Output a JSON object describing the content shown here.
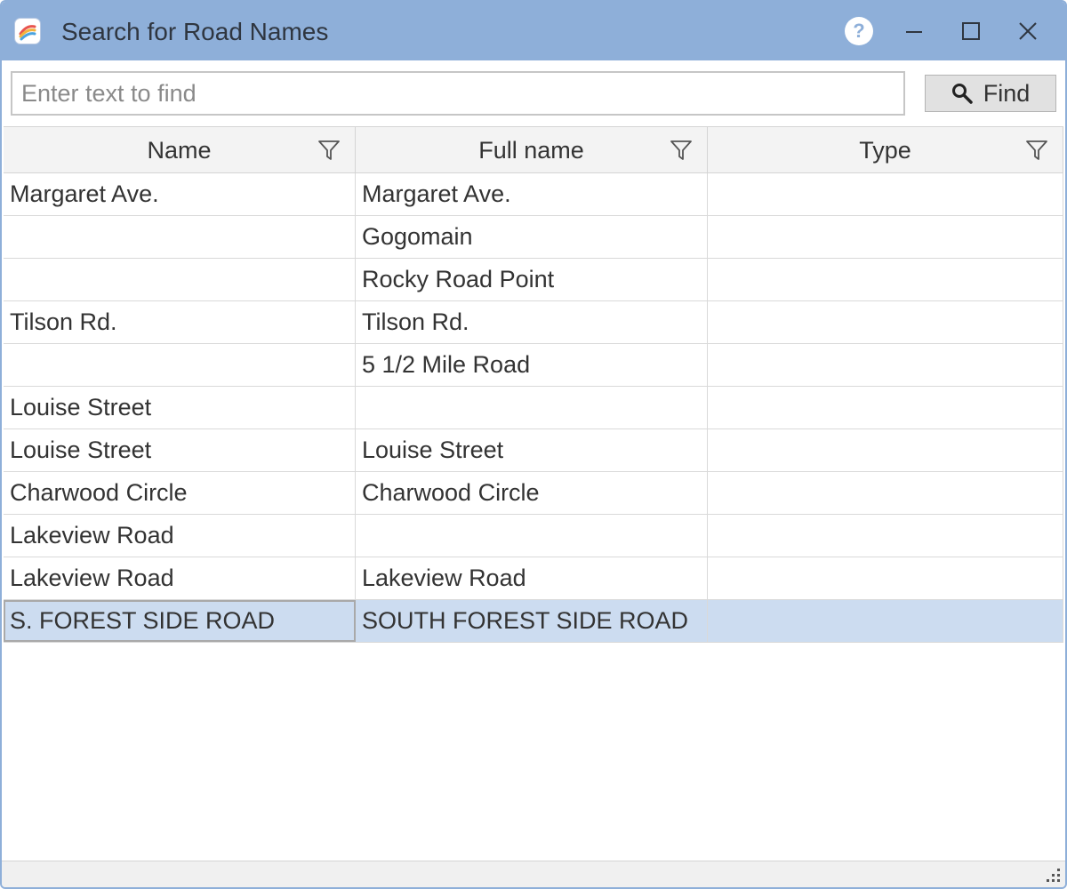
{
  "window": {
    "title": "Search for Road Names",
    "app_icon": "app-icon",
    "controls": [
      "help-icon",
      "minimize-icon",
      "maximize-icon",
      "close-icon"
    ],
    "help_glyph": "?"
  },
  "search": {
    "value": "",
    "placeholder": "Enter text to find",
    "find_label": "Find"
  },
  "grid": {
    "columns": [
      {
        "label": "Name"
      },
      {
        "label": "Full name"
      },
      {
        "label": "Type"
      }
    ],
    "rows": [
      {
        "name": "Margaret Ave.",
        "full_name": "Margaret Ave.",
        "type": ""
      },
      {
        "name": "",
        "full_name": "Gogomain",
        "type": ""
      },
      {
        "name": "",
        "full_name": "Rocky Road Point",
        "type": ""
      },
      {
        "name": "Tilson Rd.",
        "full_name": "Tilson Rd.",
        "type": ""
      },
      {
        "name": "",
        "full_name": "5 1/2 Mile Road",
        "type": ""
      },
      {
        "name": "Louise Street",
        "full_name": "",
        "type": ""
      },
      {
        "name": "Louise Street",
        "full_name": "Louise Street",
        "type": ""
      },
      {
        "name": "Charwood Circle",
        "full_name": "Charwood Circle",
        "type": ""
      },
      {
        "name": "Lakeview Road",
        "full_name": "",
        "type": ""
      },
      {
        "name": "Lakeview Road",
        "full_name": "Lakeview Road",
        "type": ""
      },
      {
        "name": "S. FOREST SIDE ROAD",
        "full_name": "SOUTH FOREST SIDE ROAD",
        "type": ""
      }
    ],
    "selected_row": 10
  },
  "colors": {
    "titlebar": "#8eafd9",
    "selection": "#ccdcf0",
    "button_face": "#e1e1e1"
  }
}
